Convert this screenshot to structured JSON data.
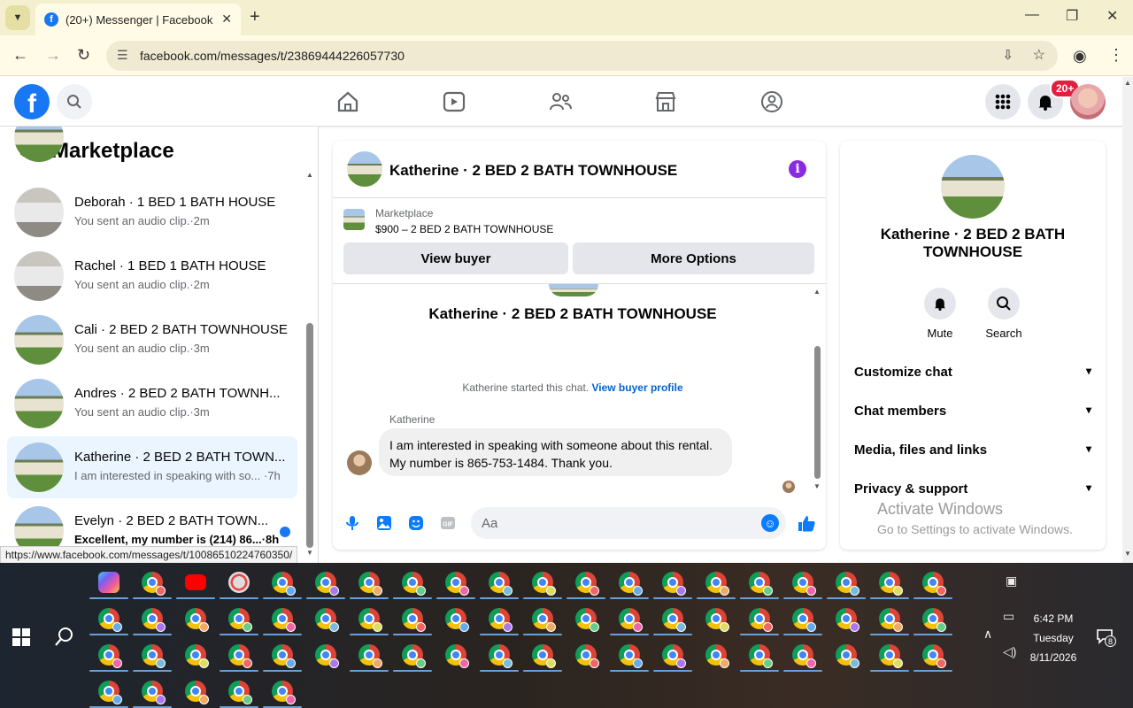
{
  "browser": {
    "tab_title": "(20+) Messenger | Facebook",
    "url": "facebook.com/messages/t/23869444226057730",
    "status_url": "https://www.facebook.com/messages/t/10086510224760350/"
  },
  "fb": {
    "notification_badge": "20+"
  },
  "left_panel": {
    "title": "Marketplace",
    "conversations": [
      {
        "title": "Deborah · 1 BED 1 BATH HOUSE",
        "subtitle": "You sent an audio clip.·2m",
        "thumb": "room",
        "active": false,
        "unread": false
      },
      {
        "title": "Rachel · 1 BED 1 BATH HOUSE",
        "subtitle": "You sent an audio clip.·2m",
        "thumb": "room",
        "active": false,
        "unread": false
      },
      {
        "title": "Cali · 2 BED 2 BATH TOWNHOUSE",
        "subtitle": "You sent an audio clip.·3m",
        "thumb": "house",
        "active": false,
        "unread": false
      },
      {
        "title": "Andres · 2 BED 2 BATH TOWNH...",
        "subtitle": "You sent an audio clip.·3m",
        "thumb": "house",
        "active": false,
        "unread": false
      },
      {
        "title": "Katherine · 2 BED 2 BATH TOWN...",
        "subtitle": "I am interested in speaking with so... ·7h",
        "thumb": "house",
        "active": true,
        "unread": false
      },
      {
        "title": "Evelyn · 2 BED 2 BATH TOWN...",
        "subtitle": "Excellent, my number is (214) 86...·8h",
        "thumb": "house",
        "active": false,
        "unread": true
      }
    ]
  },
  "chat": {
    "title": "Katherine · 2 BED 2 BATH TOWNHOUSE",
    "listing_label": "Marketplace",
    "listing_price": "$900 – 2 BED 2 BATH TOWNHOUSE",
    "view_buyer_label": "View buyer",
    "more_options_label": "More Options",
    "intro_name": "Katherine · 2 BED 2 BATH TOWNHOUSE",
    "started_text": "Katherine started this chat.",
    "view_profile_label": "View buyer profile",
    "sender": "Katherine",
    "message": "I am interested in speaking with someone about this rental.  My number is 865-753-1484.  Thank you.",
    "composer_placeholder": "Aa"
  },
  "right_panel": {
    "name": "Katherine · 2 BED 2 BATH TOWNHOUSE",
    "mute_label": "Mute",
    "search_label": "Search",
    "sections": [
      "Customize chat",
      "Chat members",
      "Media, files and links",
      "Privacy & support"
    ]
  },
  "watermark": {
    "line1": "Activate Windows",
    "line2": "Go to Settings to activate Windows."
  },
  "taskbar": {
    "time": "6:42 PM",
    "day": "Tuesday",
    "date": "8/11/2026",
    "notification_count": "8"
  },
  "colors": {
    "fb_blue": "#1877f2",
    "chrome_tab_bg": "#f4f0cf",
    "active_conv_bg": "#ebf5ff",
    "info_purple": "#8a2be2"
  }
}
